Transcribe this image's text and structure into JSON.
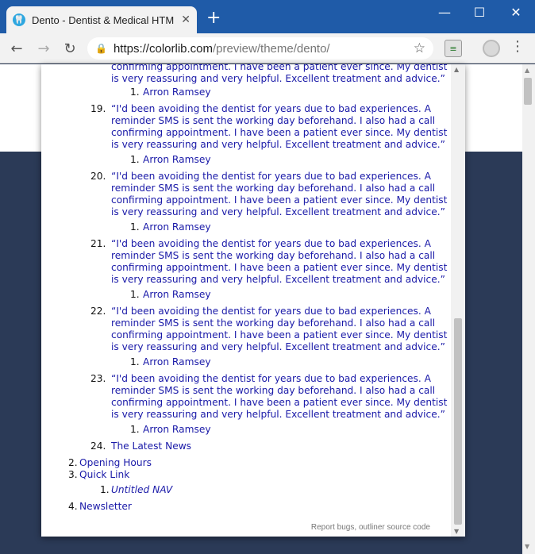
{
  "browser": {
    "tab_title": "Dento - Dentist & Medical HTM",
    "url_host": "https://colorlib.com",
    "url_path": "/preview/theme/dento/"
  },
  "outline": {
    "top_quote_tail": [
      "confirming appointment. I have been a patient ever since. My dentist",
      "is very reassuring and very helpful. Excellent treatment and advice.”"
    ],
    "top_author_num": "1.",
    "top_author": "Arron Ramsey",
    "testimonials": [
      {
        "num": "19.",
        "lines": [
          "“I'd been avoiding the dentist for years due to bad experiences. A",
          "reminder SMS is sent the working day beforehand. I also had a call",
          "confirming appointment. I have been a patient ever since. My dentist",
          "is very reassuring and very helpful. Excellent treatment and advice.”"
        ],
        "author_num": "1.",
        "author": "Arron Ramsey"
      },
      {
        "num": "20.",
        "lines": [
          "“I'd been avoiding the dentist for years due to bad experiences. A",
          "reminder SMS is sent the working day beforehand. I also had a call",
          "confirming appointment. I have been a patient ever since. My dentist",
          "is very reassuring and very helpful. Excellent treatment and advice.”"
        ],
        "author_num": "1.",
        "author": "Arron Ramsey"
      },
      {
        "num": "21.",
        "lines": [
          "“I'd been avoiding the dentist for years due to bad experiences. A",
          "reminder SMS is sent the working day beforehand. I also had a call",
          "confirming appointment. I have been a patient ever since. My dentist",
          "is very reassuring and very helpful. Excellent treatment and advice.”"
        ],
        "author_num": "1.",
        "author": "Arron Ramsey"
      },
      {
        "num": "22.",
        "lines": [
          "“I'd been avoiding the dentist for years due to bad experiences. A",
          "reminder SMS is sent the working day beforehand. I also had a call",
          "confirming appointment. I have been a patient ever since. My dentist",
          "is very reassuring and very helpful. Excellent treatment and advice.”"
        ],
        "author_num": "1.",
        "author": "Arron Ramsey"
      },
      {
        "num": "23.",
        "lines": [
          "“I'd been avoiding the dentist for years due to bad experiences. A",
          "reminder SMS is sent the working day beforehand. I also had a call",
          "confirming appointment. I have been a patient ever since. My dentist",
          "is very reassuring and very helpful. Excellent treatment and advice.”"
        ],
        "author_num": "1.",
        "author": "Arron Ramsey"
      }
    ],
    "latest_news": {
      "num": "24.",
      "label": "The Latest News"
    },
    "sections": [
      {
        "num": "2.",
        "label": "Opening Hours"
      },
      {
        "num": "3.",
        "label": "Quick Link"
      },
      {
        "num": "4.",
        "label": "Newsletter"
      }
    ],
    "quick_link_child": {
      "num": "1.",
      "label": "Untitled NAV"
    },
    "footer_bugs": "Report bugs",
    "footer_sep": ", ",
    "footer_source": "outliner source code"
  },
  "icons": {
    "favicon": "tooth-icon",
    "close": "close-icon",
    "new_tab": "plus-icon",
    "back": "back-arrow-icon",
    "forward": "forward-arrow-icon",
    "reload": "reload-icon",
    "lock": "lock-icon",
    "star": "star-icon",
    "extension": "outliner-extension-icon",
    "profile": "profile-avatar-icon",
    "menu": "kebab-menu-icon"
  }
}
